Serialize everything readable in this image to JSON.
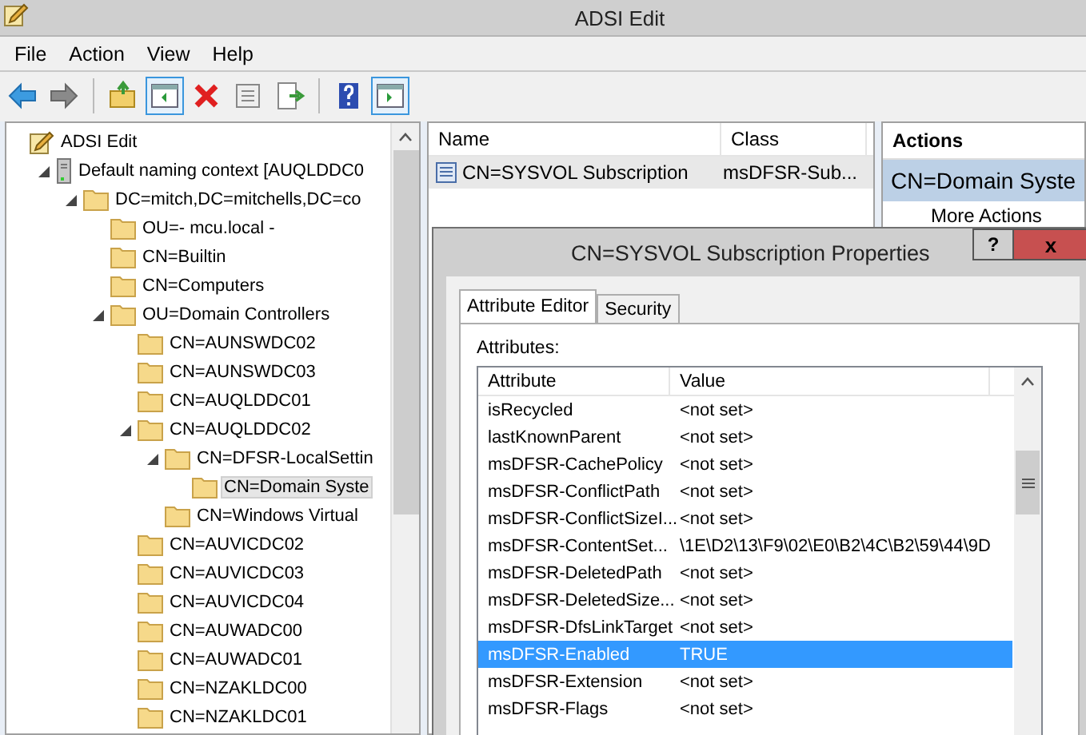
{
  "window": {
    "title": "ADSI Edit"
  },
  "menu": [
    "File",
    "Action",
    "View",
    "Help"
  ],
  "toolbar": [
    {
      "kind": "back",
      "pressed": false
    },
    {
      "kind": "forward",
      "pressed": false
    },
    {
      "kind": "up",
      "pressed": false
    },
    {
      "kind": "tree-toggle",
      "pressed": true
    },
    {
      "kind": "delete",
      "pressed": false
    },
    {
      "kind": "properties",
      "pressed": false
    },
    {
      "kind": "export",
      "pressed": false
    },
    {
      "kind": "help",
      "pressed": false
    },
    {
      "kind": "pane-toggle",
      "pressed": true
    }
  ],
  "tree": [
    {
      "label": "ADSI Edit",
      "kind": "root",
      "selected": false,
      "children": [
        {
          "label": "Default naming context [AUQLDDC0",
          "kind": "server",
          "expanded": true,
          "selected": false,
          "children": [
            {
              "label": "DC=mitch,DC=mitchells,DC=co",
              "kind": "folder",
              "expanded": true,
              "selected": false,
              "children": [
                {
                  "label": "OU=- mcu.local -",
                  "kind": "folder",
                  "selected": false
                },
                {
                  "label": "CN=Builtin",
                  "kind": "folder",
                  "selected": false
                },
                {
                  "label": "CN=Computers",
                  "kind": "folder",
                  "selected": false
                },
                {
                  "label": "OU=Domain Controllers",
                  "kind": "folder",
                  "expanded": true,
                  "selected": false,
                  "children": [
                    {
                      "label": "CN=AUNSWDC02",
                      "kind": "folder",
                      "selected": false
                    },
                    {
                      "label": "CN=AUNSWDC03",
                      "kind": "folder",
                      "selected": false
                    },
                    {
                      "label": "CN=AUQLDDC01",
                      "kind": "folder",
                      "selected": false
                    },
                    {
                      "label": "CN=AUQLDDC02",
                      "kind": "folder",
                      "expanded": true,
                      "selected": false,
                      "children": [
                        {
                          "label": "CN=DFSR-LocalSettin",
                          "kind": "folder",
                          "expanded": true,
                          "selected": false,
                          "children": [
                            {
                              "label": "CN=Domain Syste",
                              "kind": "folder",
                              "selected": true
                            }
                          ]
                        },
                        {
                          "label": "CN=Windows Virtual",
                          "kind": "folder",
                          "selected": false
                        }
                      ]
                    },
                    {
                      "label": "CN=AUVICDC02",
                      "kind": "folder",
                      "selected": false
                    },
                    {
                      "label": "CN=AUVICDC03",
                      "kind": "folder",
                      "selected": false
                    },
                    {
                      "label": "CN=AUVICDC04",
                      "kind": "folder",
                      "selected": false
                    },
                    {
                      "label": "CN=AUWADC00",
                      "kind": "folder",
                      "selected": false
                    },
                    {
                      "label": "CN=AUWADC01",
                      "kind": "folder",
                      "selected": false
                    },
                    {
                      "label": "CN=NZAKLDC00",
                      "kind": "folder",
                      "selected": false
                    },
                    {
                      "label": "CN=NZAKLDC01",
                      "kind": "folder",
                      "selected": false
                    }
                  ]
                }
              ]
            }
          ]
        }
      ]
    }
  ],
  "list": {
    "columns": [
      "Name",
      "Class"
    ],
    "rows": [
      {
        "name": "CN=SYSVOL Subscription",
        "class": "msDFSR-Sub...",
        "selected": true
      }
    ]
  },
  "actions": {
    "title": "Actions",
    "section": "CN=Domain Syste",
    "items": [
      "More Actions"
    ]
  },
  "dialog": {
    "title": "CN=SYSVOL Subscription Properties",
    "help": "?",
    "close": "x",
    "tabs": [
      {
        "label": "Attribute Editor",
        "selected": true
      },
      {
        "label": "Security",
        "selected": false
      }
    ],
    "attributes_label": "Attributes:",
    "columns": [
      "Attribute",
      "Value"
    ],
    "rows": [
      {
        "attribute": "isRecycled",
        "value": "<not set>",
        "selected": false
      },
      {
        "attribute": "lastKnownParent",
        "value": "<not set>",
        "selected": false
      },
      {
        "attribute": "msDFSR-CachePolicy",
        "value": "<not set>",
        "selected": false
      },
      {
        "attribute": "msDFSR-ConflictPath",
        "value": "<not set>",
        "selected": false
      },
      {
        "attribute": "msDFSR-ConflictSizeI...",
        "value": "<not set>",
        "selected": false
      },
      {
        "attribute": "msDFSR-ContentSet...",
        "value": "\\1E\\D2\\13\\F9\\02\\E0\\B2\\4C\\B2\\59\\44\\9D",
        "selected": false
      },
      {
        "attribute": "msDFSR-DeletedPath",
        "value": "<not set>",
        "selected": false
      },
      {
        "attribute": "msDFSR-DeletedSize...",
        "value": "<not set>",
        "selected": false
      },
      {
        "attribute": "msDFSR-DfsLinkTarget",
        "value": "<not set>",
        "selected": false
      },
      {
        "attribute": "msDFSR-Enabled",
        "value": "TRUE",
        "selected": true
      },
      {
        "attribute": "msDFSR-Extension",
        "value": "<not set>",
        "selected": false
      },
      {
        "attribute": "msDFSR-Flags",
        "value": "<not set>",
        "selected": false
      }
    ]
  }
}
